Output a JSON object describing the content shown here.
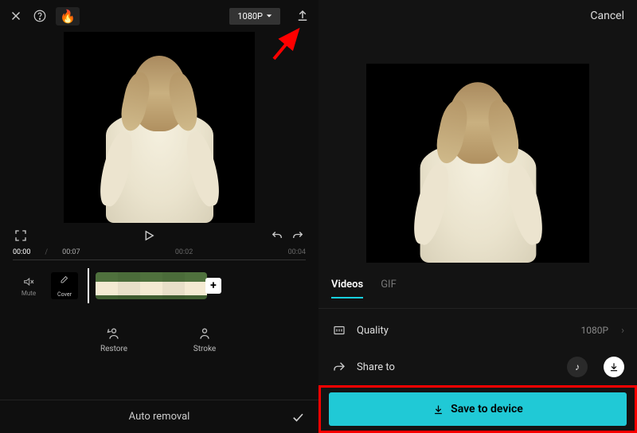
{
  "editor": {
    "resolution": "1080P",
    "time_current": "00:00",
    "time_total": "00:07",
    "time_marks": [
      "00:02",
      "00:04"
    ],
    "track_mute": "Mute",
    "track_cover": "Cover",
    "fx_restore": "Restore",
    "fx_stroke": "Stroke",
    "bottom_label": "Auto removal"
  },
  "export": {
    "cancel": "Cancel",
    "tabs": {
      "videos": "Videos",
      "gif": "GIF"
    },
    "quality_label": "Quality",
    "quality_value": "1080P",
    "share_label": "Share to",
    "save_label": "Save to device"
  },
  "share_targets": {
    "tiktok": "♪"
  },
  "colors": {
    "accent": "#20c9d6",
    "annotation": "#ff0000"
  }
}
